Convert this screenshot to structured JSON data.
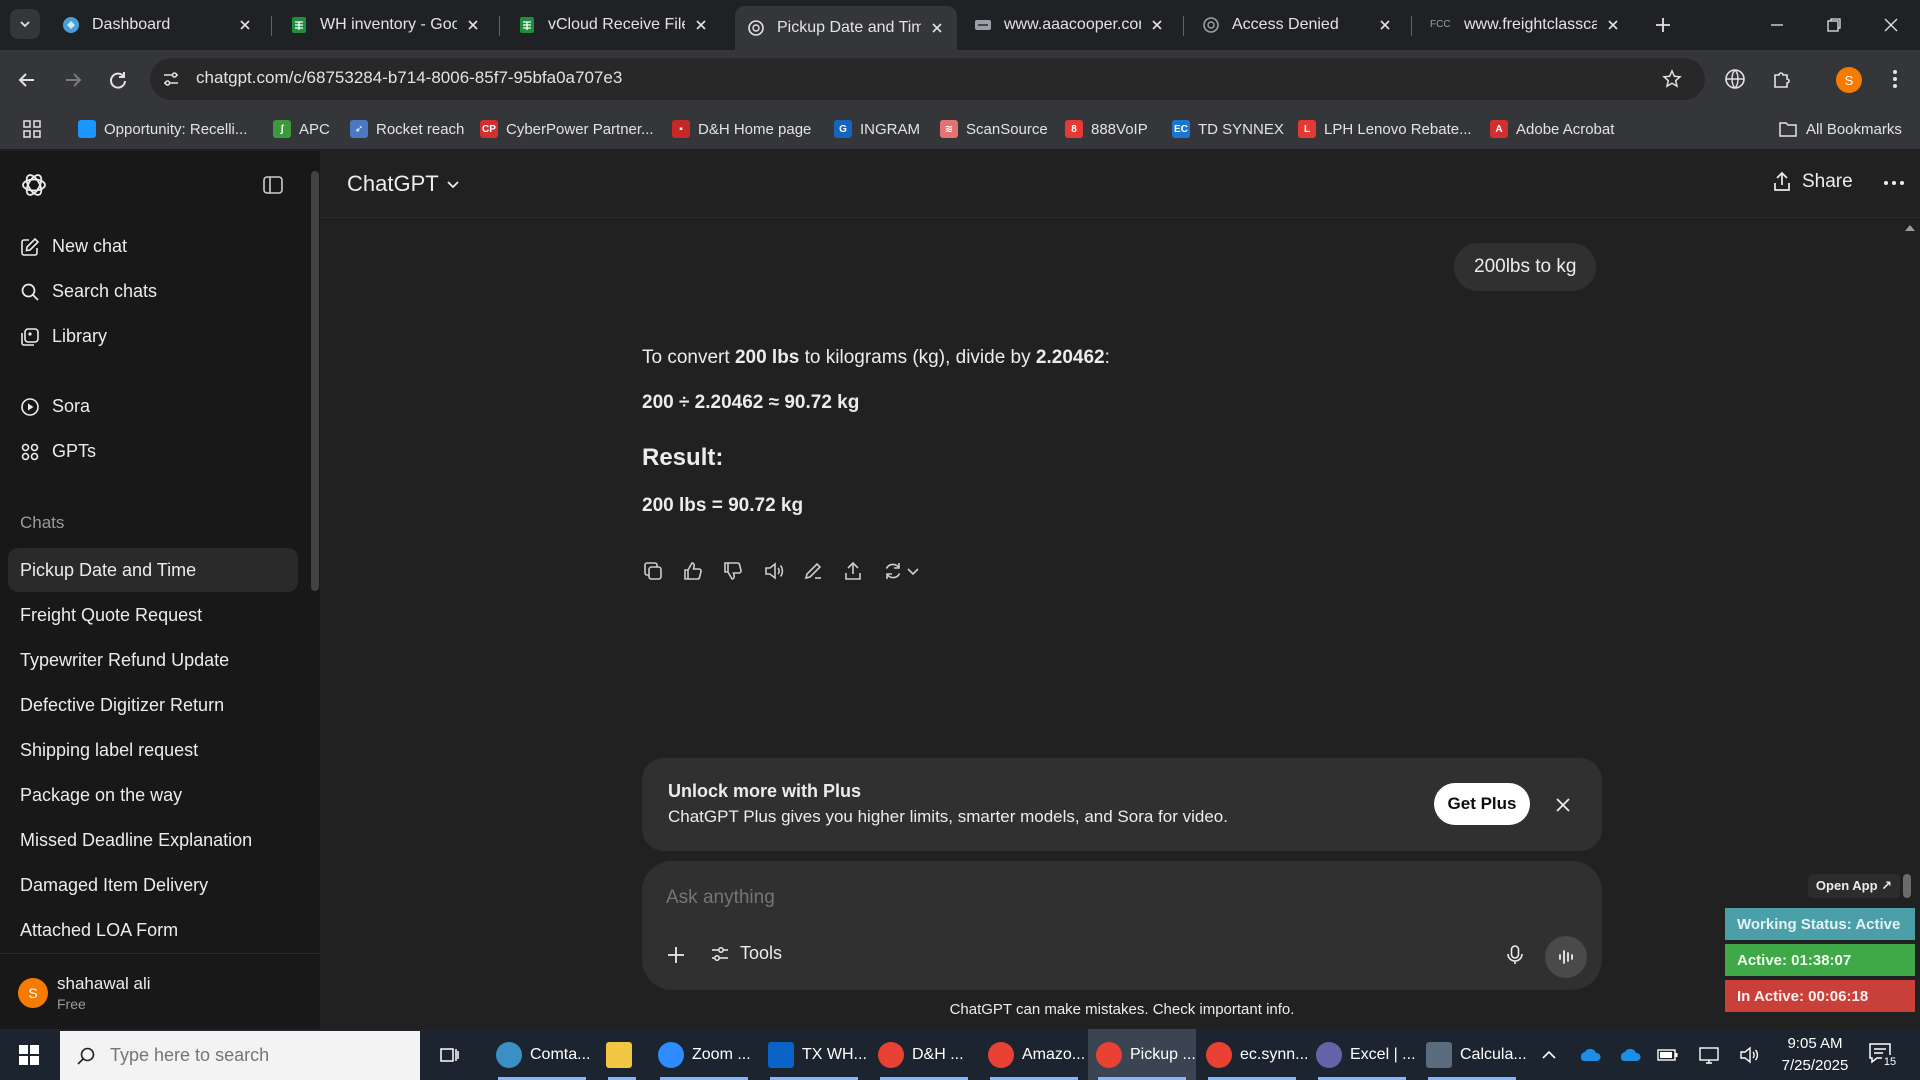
{
  "tabs": [
    {
      "title": "Dashboard",
      "icon": "dashboard-icon",
      "color": "#4a9fd8"
    },
    {
      "title": "WH inventory - Goog",
      "icon": "sheets-icon",
      "color": "#1e8e3e"
    },
    {
      "title": "vCloud Receive File -",
      "icon": "sheets-icon",
      "color": "#1e8e3e"
    },
    {
      "title": "Pickup Date and Tim",
      "icon": "chatgpt-icon",
      "color": "#e3e3e3"
    },
    {
      "title": "www.aaacooper.com",
      "icon": "site-icon",
      "color": "#9aa0a6"
    },
    {
      "title": "Access Denied",
      "icon": "chatgpt-icon",
      "color": "#9aa0a6"
    },
    {
      "title": "www.freightclasscalc",
      "icon": "fcc-icon",
      "color": "#9aa0a6"
    }
  ],
  "fcc_label": "FCC",
  "address": "chatgpt.com/c/68753284-b714-8006-85f7-95bfa0a707e3",
  "bookmarks": [
    {
      "label": "Opportunity: Recelli...",
      "icon": "cloud-icon",
      "color": "#1b96ff",
      "glyph": ""
    },
    {
      "label": "APC",
      "icon": "apc-icon",
      "color": "#3c9a3c",
      "glyph": "ʃ"
    },
    {
      "label": "Rocket reach",
      "icon": "rocket-icon",
      "color": "#4a78c2",
      "glyph": "➶"
    },
    {
      "label": "CyberPower Partner...",
      "icon": "cp-icon",
      "color": "#d32f2f",
      "glyph": "CP"
    },
    {
      "label": "D&H Home page",
      "icon": "dh-icon",
      "color": "#c62828",
      "glyph": "▪"
    },
    {
      "label": "INGRAM",
      "icon": "ingram-icon",
      "color": "#1565c0",
      "glyph": "G"
    },
    {
      "label": "ScanSource",
      "icon": "scansource-icon",
      "color": "#e57373",
      "glyph": "≋"
    },
    {
      "label": "888VoIP",
      "icon": "voip-icon",
      "color": "#e53935",
      "glyph": "8"
    },
    {
      "label": "TD SYNNEX",
      "icon": "tdsynnex-icon",
      "color": "#1976d2",
      "glyph": "EC"
    },
    {
      "label": "LPH Lenovo Rebate...",
      "icon": "lenovo-icon",
      "color": "#e53935",
      "glyph": "L"
    },
    {
      "label": "Adobe Acrobat",
      "icon": "acrobat-icon",
      "color": "#d32f2f",
      "glyph": "A"
    }
  ],
  "all_bookmarks": "All Bookmarks",
  "profile_initial": "S",
  "sidebar": {
    "new_chat": "New chat",
    "search_chats": "Search chats",
    "library": "Library",
    "sora": "Sora",
    "gpts": "GPTs",
    "chats_heading": "Chats",
    "chats": [
      "Pickup Date and Time",
      "Freight Quote Request",
      "Typewriter Refund Update",
      "Defective Digitizer Return",
      "Shipping label request",
      "Package on the way",
      "Missed Deadline Explanation",
      "Damaged Item Delivery",
      "Attached LOA Form"
    ],
    "user_name": "shahawal ali",
    "user_plan": "Free",
    "user_initial": "S"
  },
  "header": {
    "model": "ChatGPT",
    "share": "Share"
  },
  "conversation": {
    "user_message": "200lbs to kg",
    "intro_1": "To convert ",
    "intro_b1": "200 lbs",
    "intro_2": " to kilograms (kg), divide by ",
    "intro_b2": "2.20462",
    "intro_3": ":",
    "formula": "200 ÷ 2.20462 ≈ 90.72 kg",
    "result_heading": "Result:",
    "result_line": "200 lbs = 90.72 kg"
  },
  "promo": {
    "title": "Unlock more with Plus",
    "body": "ChatGPT Plus gives you higher limits, smarter models, and Sora for video.",
    "button": "Get Plus"
  },
  "composer": {
    "placeholder": "Ask anything",
    "tools": "Tools"
  },
  "disclaimer": "ChatGPT can make mistakes. Check important info.",
  "widget": {
    "open_app": "Open App ↗",
    "status": "Working Status: Active",
    "active": "Active: 01:38:07",
    "inactive": "In Active: 00:06:18",
    "status_color": "#4a9fa8",
    "active_color": "#3fa847",
    "inactive_color": "#c9403b"
  },
  "taskbar": {
    "search_placeholder": "Type here to search",
    "apps": [
      {
        "label": "Comta...",
        "icon": "comtasks-icon",
        "color": "#3a8fc4"
      },
      {
        "label": "",
        "icon": "file-explorer-icon",
        "color": "#f2c744"
      },
      {
        "label": "Zoom ...",
        "icon": "zoom-icon",
        "color": "#2d8cff"
      },
      {
        "label": "TX WH...",
        "icon": "outlook-icon",
        "color": "#0a64c8"
      },
      {
        "label": "D&H ...",
        "icon": "chrome-icon",
        "color": "#e94235"
      },
      {
        "label": "Amazo...",
        "icon": "chrome-icon",
        "color": "#e94235"
      },
      {
        "label": "Pickup ...",
        "icon": "chrome-icon",
        "color": "#e94235"
      },
      {
        "label": "ec.synn...",
        "icon": "chrome-icon",
        "color": "#e94235"
      },
      {
        "label": "Excel | ...",
        "icon": "teams-icon",
        "color": "#6264a7"
      },
      {
        "label": "Calcula...",
        "icon": "calculator-icon",
        "color": "#5a6b7d"
      }
    ],
    "time": "9:05 AM",
    "date": "7/25/2025",
    "notification_count": "15"
  }
}
